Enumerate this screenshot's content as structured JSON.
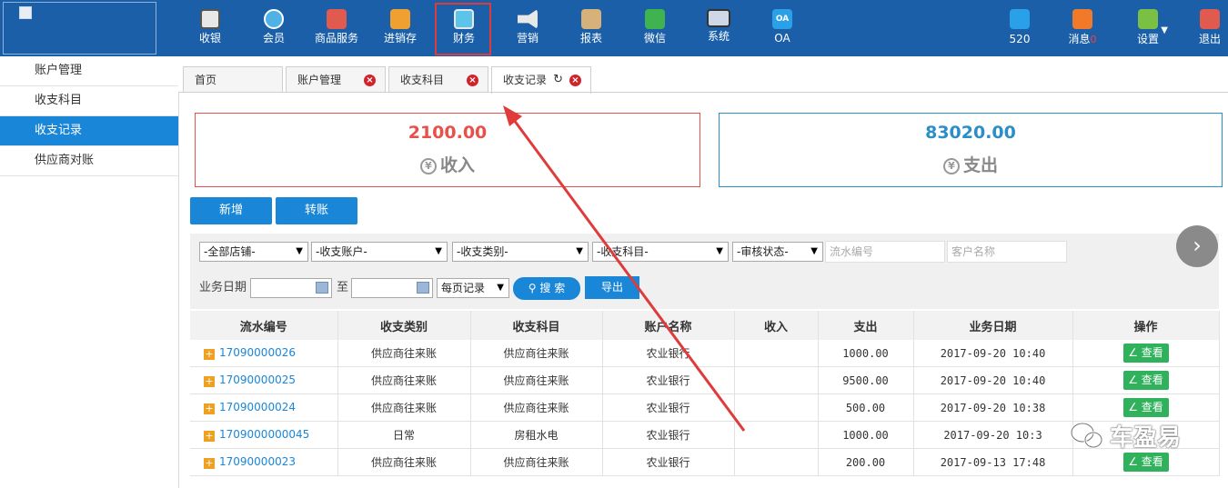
{
  "nav": {
    "items": [
      {
        "label": "收银",
        "icon": "cash-register-icon",
        "color": "#e8e8e8"
      },
      {
        "label": "会员",
        "icon": "member-icon",
        "color": "#4fb1e6"
      },
      {
        "label": "商品服务",
        "icon": "product-icon",
        "color": "#e05a4f"
      },
      {
        "label": "进销存",
        "icon": "inventory-icon",
        "color": "#f0a030"
      },
      {
        "label": "财务",
        "icon": "finance-icon",
        "color": "#5cc4e8"
      },
      {
        "label": "营销",
        "icon": "marketing-icon",
        "color": "#e8e8e8"
      },
      {
        "label": "报表",
        "icon": "report-icon",
        "color": "#d6b27a"
      },
      {
        "label": "微信",
        "icon": "wechat-icon",
        "color": "#3fb34f"
      },
      {
        "label": "系统",
        "icon": "system-icon",
        "color": "#cfd8e6"
      },
      {
        "label": "OA",
        "icon": "oa-icon",
        "color": "#2aa0e8"
      }
    ],
    "user": {
      "label": "520",
      "icon": "user-icon",
      "color": "#2aa0e8"
    },
    "messages": {
      "label": "消息",
      "count": "0",
      "icon": "bell-icon",
      "color": "#f07a2a"
    },
    "settings": {
      "label": "设置",
      "icon": "gear-icon",
      "color": "#7ac043"
    },
    "logout": {
      "label": "退出",
      "icon": "logout-icon",
      "color": "#e05a4f"
    }
  },
  "sidebar": {
    "items": [
      {
        "label": "账户管理"
      },
      {
        "label": "收支科目"
      },
      {
        "label": "收支记录",
        "active": true
      },
      {
        "label": "供应商对账"
      }
    ]
  },
  "tabs": [
    {
      "label": "首页"
    },
    {
      "label": "账户管理"
    },
    {
      "label": "收支科目"
    },
    {
      "label": "收支记录",
      "active": true
    }
  ],
  "summary": {
    "income": {
      "value": "2100.00",
      "label": "收入"
    },
    "expense": {
      "value": "83020.00",
      "label": "支出"
    }
  },
  "actions": {
    "add": "新增",
    "transfer": "转账"
  },
  "filters": {
    "store": "-全部店铺-",
    "account": "-收支账户-",
    "category": "-收支类别-",
    "subject": "-收支科目-",
    "audit": "-审核状态-",
    "serial_placeholder": "流水编号",
    "customer_placeholder": "客户名称",
    "date_label": "业务日期",
    "to_label": "至",
    "per_page": "每页记录",
    "search": "搜 索",
    "export": "导出"
  },
  "table": {
    "headers": [
      "流水编号",
      "收支类别",
      "收支科目",
      "账户名称",
      "收入",
      "支出",
      "业务日期",
      "操作"
    ],
    "view_label": "查看",
    "rows": [
      {
        "serial": "17090000026",
        "category": "供应商往来账",
        "subject": "供应商往来账",
        "account": "农业银行",
        "income": "",
        "expense": "1000.00",
        "date": "2017-09-20 10:40"
      },
      {
        "serial": "17090000025",
        "category": "供应商往来账",
        "subject": "供应商往来账",
        "account": "农业银行",
        "income": "",
        "expense": "9500.00",
        "date": "2017-09-20 10:40"
      },
      {
        "serial": "17090000024",
        "category": "供应商往来账",
        "subject": "供应商往来账",
        "account": "农业银行",
        "income": "",
        "expense": "500.00",
        "date": "2017-09-20 10:38"
      },
      {
        "serial": "1709000000045",
        "category": "日常",
        "subject": "房租水电",
        "account": "农业银行",
        "income": "",
        "expense": "1000.00",
        "date": "2017-09-20 10:3"
      },
      {
        "serial": "17090000023",
        "category": "供应商往来账",
        "subject": "供应商往来账",
        "account": "农业银行",
        "income": "",
        "expense": "200.00",
        "date": "2017-09-13 17:48"
      }
    ]
  },
  "watermark": "车盈易"
}
